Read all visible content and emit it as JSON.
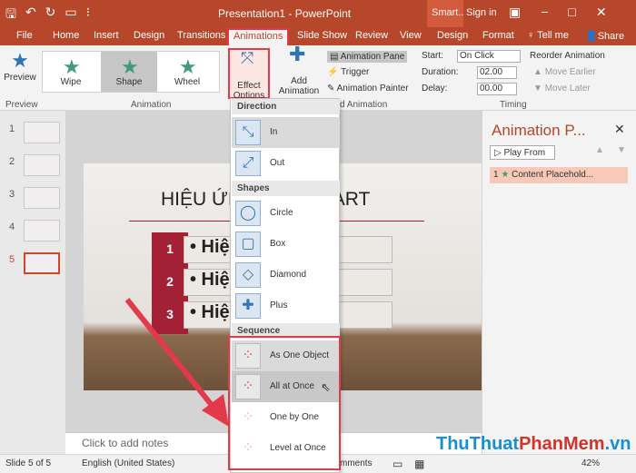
{
  "app": {
    "title": "Presentation1 - PowerPoint",
    "context_tab": "Smart...",
    "signin": "Sign in"
  },
  "tabs": [
    "File",
    "Home",
    "Insert",
    "Design",
    "Transitions",
    "Animations",
    "Slide Show",
    "Review",
    "View",
    "Design",
    "Format"
  ],
  "tellme": "Tell me",
  "share": "Share",
  "ribbon": {
    "preview": "Preview",
    "preview_group": "Preview",
    "gallery": [
      {
        "label": "Wipe"
      },
      {
        "label": "Shape"
      },
      {
        "label": "Wheel"
      }
    ],
    "animation_group": "Animation",
    "effect_options": "Effect Options",
    "add_animation": "Add Animation",
    "animation_pane": "Animation Pane",
    "trigger": "Trigger",
    "animation_painter": "Animation Painter",
    "advanced_group": "d Animation",
    "start_label": "Start:",
    "start_value": "On Click",
    "duration_label": "Duration:",
    "duration_value": "02.00",
    "delay_label": "Delay:",
    "delay_value": "00.00",
    "reorder": "Reorder Animation",
    "move_earlier": "Move Earlier",
    "move_later": "Move Later",
    "timing_group": "Timing"
  },
  "thumbnails": [
    "1",
    "2",
    "3",
    "4",
    "5"
  ],
  "slide": {
    "title": "HIỆU ỨNG SMART ART",
    "bullet": "• Hiệ",
    "nums": [
      "1",
      "2",
      "3"
    ]
  },
  "notes": "Click to add notes",
  "anim_pane": {
    "title": "Animation P...",
    "play_from": "Play From",
    "item_num": "1",
    "item_label": "Content Placehold..."
  },
  "dropdown": {
    "direction": "Direction",
    "dir_items": [
      {
        "label": "In"
      },
      {
        "label": "Out"
      }
    ],
    "shapes": "Shapes",
    "shape_items": [
      {
        "label": "Circle"
      },
      {
        "label": "Box"
      },
      {
        "label": "Diamond"
      },
      {
        "label": "Plus"
      }
    ],
    "sequence": "Sequence",
    "seq_items": [
      {
        "label": "As One Object"
      },
      {
        "label": "All at Once"
      },
      {
        "label": "One by One"
      },
      {
        "label": "Level at Once"
      }
    ]
  },
  "status": {
    "slide": "Slide 5 of 5",
    "language": "English (United States)",
    "comments": "mments",
    "zoom": "42%"
  },
  "watermark": {
    "a": "ThuThuat",
    "b": "PhanMem",
    "c": ".vn"
  },
  "colors": {
    "brand": "#b7472a",
    "highlight": "#e23a4a",
    "accent": "#2e75b6"
  }
}
